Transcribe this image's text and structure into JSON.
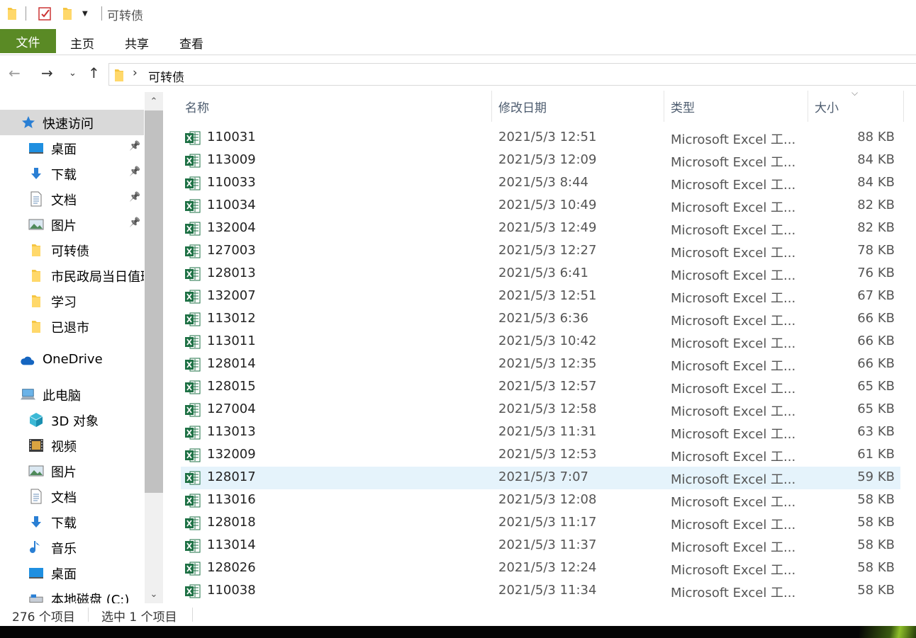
{
  "title_bar": {
    "title": "可转债"
  },
  "ribbon": {
    "file_tab": "文件",
    "tabs": [
      "主页",
      "共享",
      "查看"
    ]
  },
  "address": {
    "path": "可转债"
  },
  "sidebar": {
    "quick_access": "快速访问",
    "items": [
      {
        "label": "快速访问",
        "icon": "star-icon"
      },
      {
        "label": "桌面",
        "icon": "desktop-icon",
        "pinned": true
      },
      {
        "label": "下载",
        "icon": "download-icon",
        "pinned": true
      },
      {
        "label": "文档",
        "icon": "document-icon",
        "pinned": true
      },
      {
        "label": "图片",
        "icon": "pictures-icon",
        "pinned": true
      },
      {
        "label": "可转债",
        "icon": "folder-icon"
      },
      {
        "label": "市民政局当日值班",
        "icon": "folder-icon"
      },
      {
        "label": "学习",
        "icon": "folder-icon"
      },
      {
        "label": "已退市",
        "icon": "folder-icon"
      },
      {
        "label": "OneDrive",
        "icon": "cloud-icon"
      },
      {
        "label": "此电脑",
        "icon": "computer-icon"
      },
      {
        "label": "3D 对象",
        "icon": "cube-icon"
      },
      {
        "label": "视频",
        "icon": "video-icon"
      },
      {
        "label": "图片",
        "icon": "pictures-icon"
      },
      {
        "label": "文档",
        "icon": "document-icon"
      },
      {
        "label": "下载",
        "icon": "download-icon"
      },
      {
        "label": "音乐",
        "icon": "music-icon"
      },
      {
        "label": "桌面",
        "icon": "desktop-icon"
      },
      {
        "label": "本地磁盘 (C:)",
        "icon": "drive-icon"
      }
    ]
  },
  "columns": {
    "name": "名称",
    "date": "修改日期",
    "type": "类型",
    "size": "大小"
  },
  "files": [
    {
      "name": "110031",
      "date": "2021/5/3 12:51",
      "type": "Microsoft Excel 工...",
      "size": "88 KB"
    },
    {
      "name": "113009",
      "date": "2021/5/3 12:09",
      "type": "Microsoft Excel 工...",
      "size": "84 KB"
    },
    {
      "name": "110033",
      "date": "2021/5/3 8:44",
      "type": "Microsoft Excel 工...",
      "size": "84 KB"
    },
    {
      "name": "110034",
      "date": "2021/5/3 10:49",
      "type": "Microsoft Excel 工...",
      "size": "82 KB"
    },
    {
      "name": "132004",
      "date": "2021/5/3 12:49",
      "type": "Microsoft Excel 工...",
      "size": "82 KB"
    },
    {
      "name": "127003",
      "date": "2021/5/3 12:27",
      "type": "Microsoft Excel 工...",
      "size": "78 KB"
    },
    {
      "name": "128013",
      "date": "2021/5/3 6:41",
      "type": "Microsoft Excel 工...",
      "size": "76 KB"
    },
    {
      "name": "132007",
      "date": "2021/5/3 12:51",
      "type": "Microsoft Excel 工...",
      "size": "67 KB"
    },
    {
      "name": "113012",
      "date": "2021/5/3 6:36",
      "type": "Microsoft Excel 工...",
      "size": "66 KB"
    },
    {
      "name": "113011",
      "date": "2021/5/3 10:42",
      "type": "Microsoft Excel 工...",
      "size": "66 KB"
    },
    {
      "name": "128014",
      "date": "2021/5/3 12:35",
      "type": "Microsoft Excel 工...",
      "size": "66 KB"
    },
    {
      "name": "128015",
      "date": "2021/5/3 12:57",
      "type": "Microsoft Excel 工...",
      "size": "65 KB"
    },
    {
      "name": "127004",
      "date": "2021/5/3 12:58",
      "type": "Microsoft Excel 工...",
      "size": "65 KB"
    },
    {
      "name": "113013",
      "date": "2021/5/3 11:31",
      "type": "Microsoft Excel 工...",
      "size": "63 KB"
    },
    {
      "name": "132009",
      "date": "2021/5/3 12:53",
      "type": "Microsoft Excel 工...",
      "size": "61 KB"
    },
    {
      "name": "128017",
      "date": "2021/5/3 7:07",
      "type": "Microsoft Excel 工...",
      "size": "59 KB",
      "selected": true
    },
    {
      "name": "113016",
      "date": "2021/5/3 12:08",
      "type": "Microsoft Excel 工...",
      "size": "58 KB"
    },
    {
      "name": "128018",
      "date": "2021/5/3 11:17",
      "type": "Microsoft Excel 工...",
      "size": "58 KB"
    },
    {
      "name": "113014",
      "date": "2021/5/3 11:37",
      "type": "Microsoft Excel 工...",
      "size": "58 KB"
    },
    {
      "name": "128026",
      "date": "2021/5/3 12:24",
      "type": "Microsoft Excel 工...",
      "size": "58 KB"
    },
    {
      "name": "110038",
      "date": "2021/5/3 11:34",
      "type": "Microsoft Excel 工...",
      "size": "58 KB"
    }
  ],
  "status": {
    "count": "276 个项目",
    "selection": "选中 1 个项目"
  },
  "colors": {
    "file_tab_bg": "#5a8a25",
    "selected_row": "#e5f3fb",
    "excel_green": "#1e7145"
  }
}
